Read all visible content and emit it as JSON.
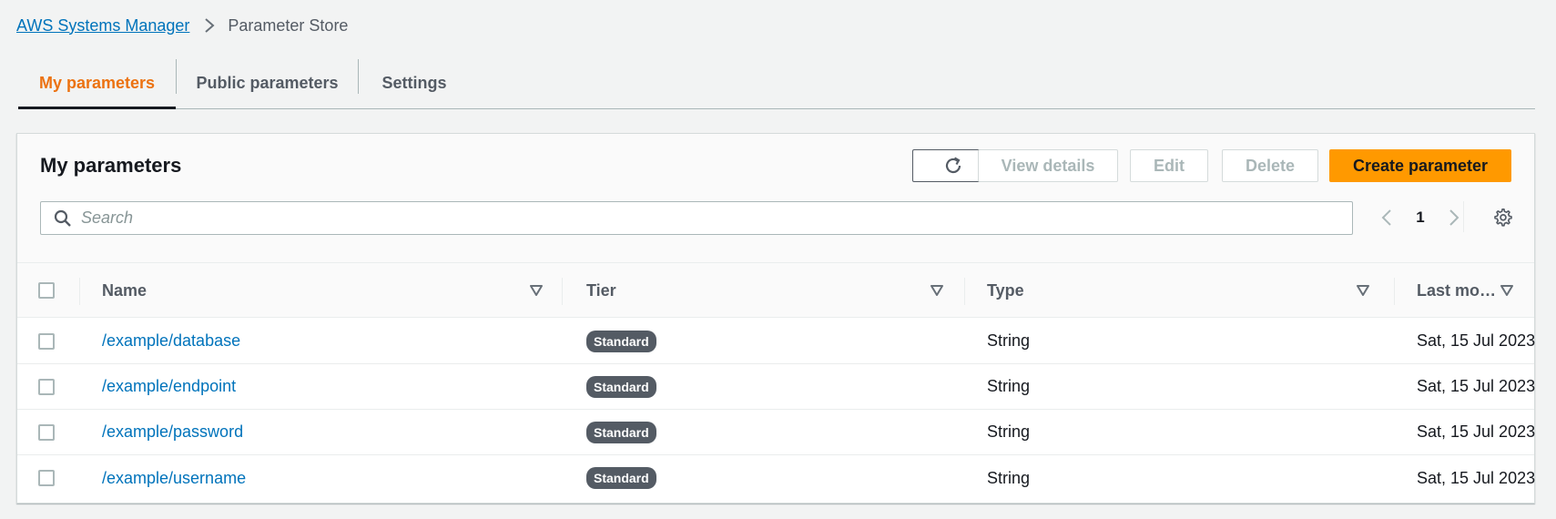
{
  "breadcrumb": {
    "parent": "AWS Systems Manager",
    "current": "Parameter Store"
  },
  "tabs": [
    {
      "label": "My parameters",
      "active": true
    },
    {
      "label": "Public parameters",
      "active": false
    },
    {
      "label": "Settings",
      "active": false
    }
  ],
  "panel": {
    "title": "My parameters",
    "buttons": {
      "view_details": "View details",
      "edit": "Edit",
      "delete": "Delete",
      "create": "Create parameter"
    },
    "search": {
      "placeholder": "Search",
      "value": ""
    },
    "pagination": {
      "current_page": "1"
    }
  },
  "table": {
    "columns": [
      "Name",
      "Tier",
      "Type",
      "Last mo…"
    ],
    "rows": [
      {
        "name": "/example/database",
        "tier": "Standard",
        "type": "String",
        "last_modified": "Sat, 15 Jul 2023"
      },
      {
        "name": "/example/endpoint",
        "tier": "Standard",
        "type": "String",
        "last_modified": "Sat, 15 Jul 2023"
      },
      {
        "name": "/example/password",
        "tier": "Standard",
        "type": "String",
        "last_modified": "Sat, 15 Jul 2023"
      },
      {
        "name": "/example/username",
        "tier": "Standard",
        "type": "String",
        "last_modified": "Sat, 15 Jul 2023"
      }
    ]
  },
  "colors": {
    "accent": "#ec7211",
    "primary_button": "#ff9900",
    "link": "#0073bb",
    "badge": "#545b64"
  }
}
